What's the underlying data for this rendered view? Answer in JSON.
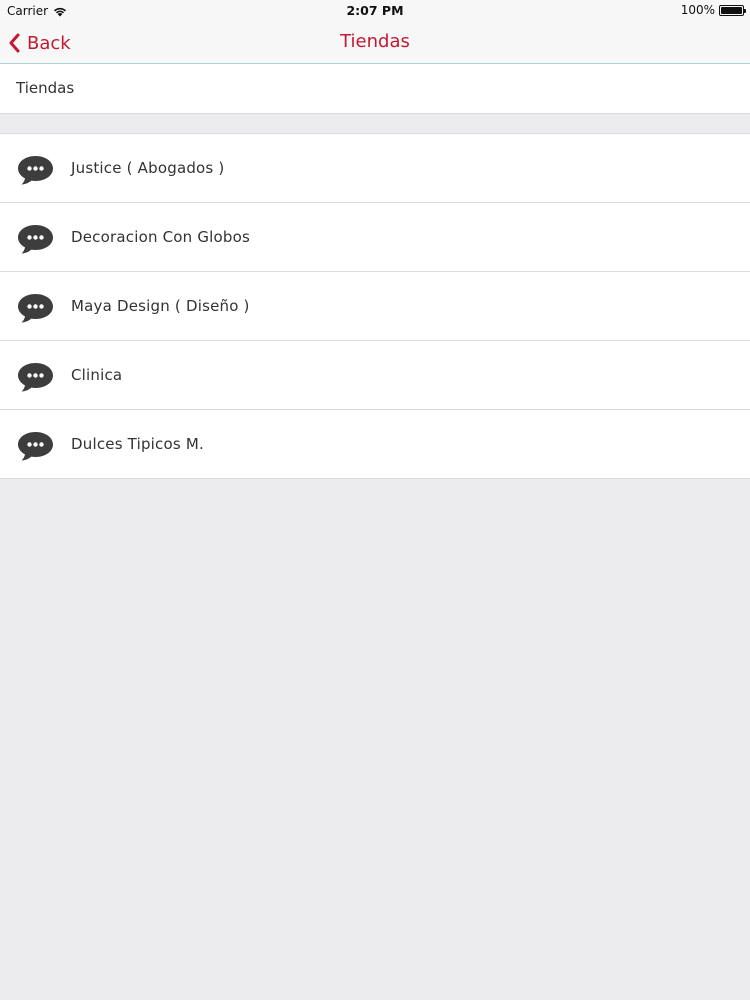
{
  "status_bar": {
    "carrier": "Carrier",
    "time": "2:07 PM",
    "battery": "100%"
  },
  "nav": {
    "back_label": "Back",
    "title": "Tiendas"
  },
  "section": {
    "header": "Tiendas"
  },
  "stores": [
    {
      "name": "Justice ( Abogados )",
      "icon": "chat-bubble-icon"
    },
    {
      "name": "Decoracion Con Globos",
      "icon": "chat-bubble-icon"
    },
    {
      "name": "Maya Design ( Diseño )",
      "icon": "chat-bubble-icon"
    },
    {
      "name": "Clinica",
      "icon": "chat-bubble-icon"
    },
    {
      "name": "Dulces Tipicos M.",
      "icon": "chat-bubble-icon"
    }
  ],
  "colors": {
    "accent": "#c21a33",
    "background": "#ececee",
    "icon": "#3d3d3d"
  }
}
